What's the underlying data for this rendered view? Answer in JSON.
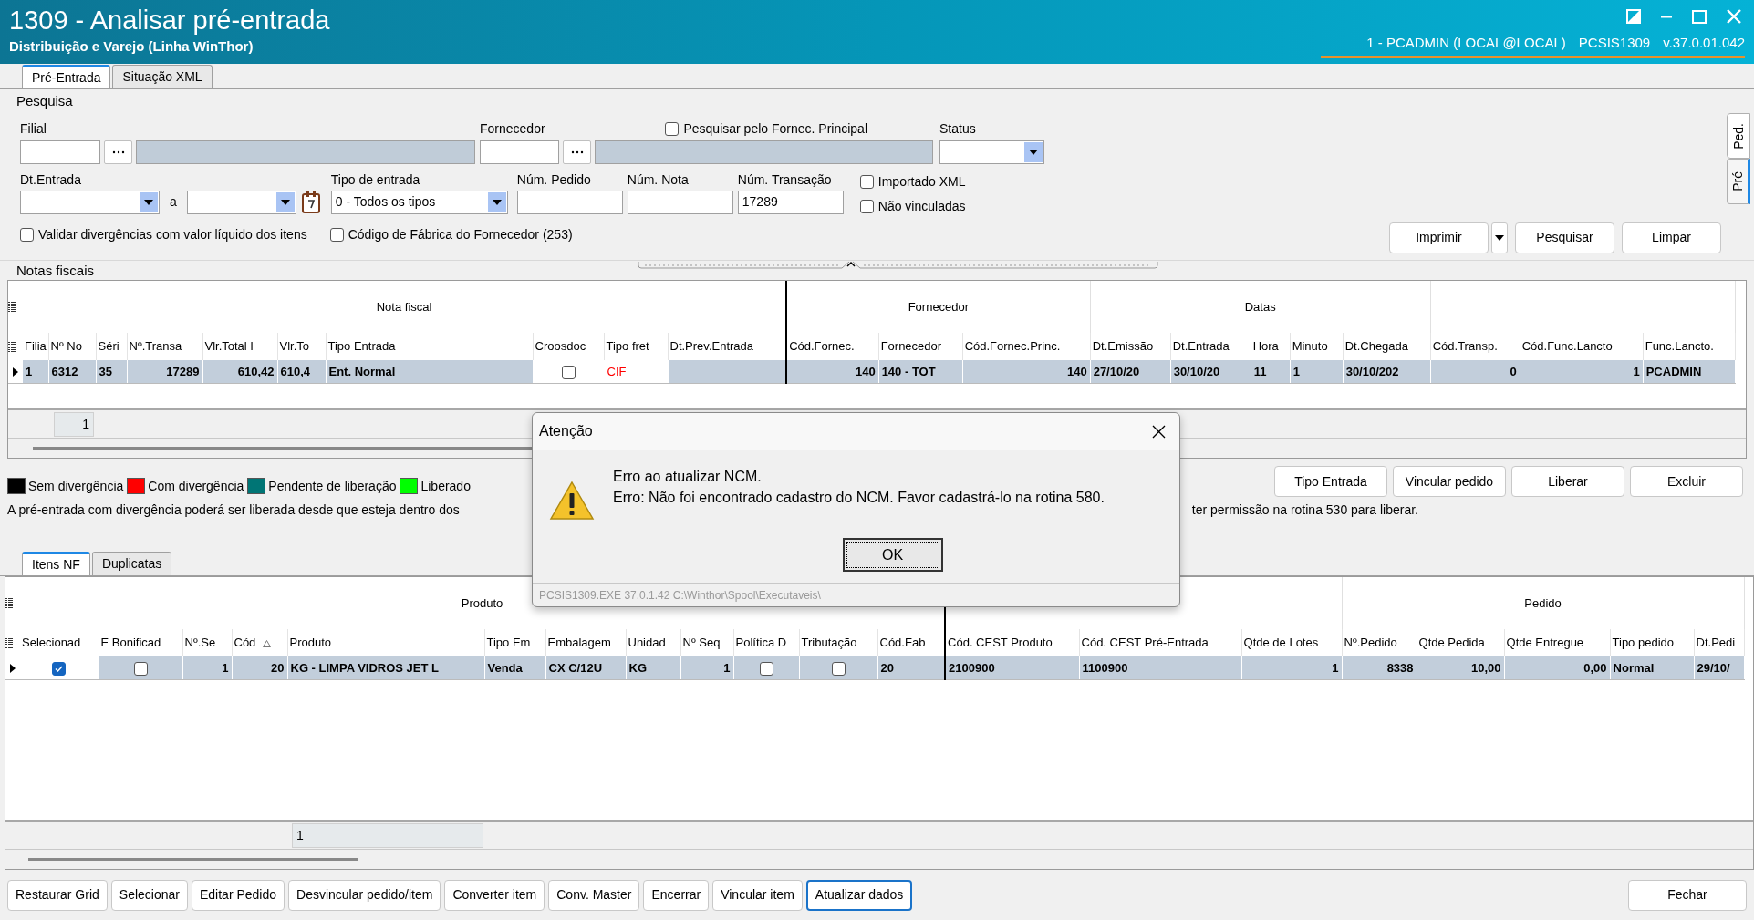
{
  "window": {
    "title": "1309 - Analisar pré-entrada",
    "subtitle": "Distribuição e Varejo (Linha WinThor)",
    "session": "1 - PCADMIN (LOCAL@LOCAL)",
    "program": "PCSIS1309",
    "version": "v.37.0.01.042"
  },
  "tabs": [
    {
      "label": "Pré-Entrada",
      "selected": true
    },
    {
      "label": "Situação XML",
      "selected": false
    }
  ],
  "search": {
    "title": "Pesquisa",
    "filial": {
      "label": "Filial"
    },
    "fornecedor": {
      "label": "Fornecedor"
    },
    "principal": {
      "label": "Pesquisar pelo Fornec. Principal",
      "checked": false
    },
    "status": {
      "label": "Status"
    },
    "dt_entrada": {
      "label": "Dt.Entrada",
      "separator": "a"
    },
    "tipo_entrada": {
      "label": "Tipo de entrada",
      "value": "0 - Todos os tipos"
    },
    "num_pedido": {
      "label": "Núm. Pedido"
    },
    "num_nota": {
      "label": "Núm. Nota"
    },
    "num_transacao": {
      "label": "Núm. Transação",
      "value": "17289"
    },
    "flags": [
      {
        "label": "Importado XML",
        "checked": false
      },
      {
        "label": "Não vinculadas",
        "checked": false
      }
    ],
    "options": [
      {
        "label": "Validar divergências com valor líquido dos itens",
        "checked": false
      },
      {
        "label": "Código de Fábrica do Fornecedor (253)",
        "checked": false
      }
    ],
    "buttons": [
      "Imprimir",
      "Pesquisar",
      "Limpar"
    ],
    "side_tabs": [
      {
        "label": "Ped.",
        "selected": false
      },
      {
        "label": "Pré",
        "selected": true
      }
    ]
  },
  "notas": {
    "title": "Notas fiscais",
    "groups": [
      "Nota fiscal",
      "Fornecedor",
      "Datas"
    ],
    "columns": [
      {
        "label": "Filia",
        "editable": false
      },
      {
        "label": "Nº No",
        "editable": false
      },
      {
        "label": "Séri",
        "editable": false
      },
      {
        "label": "Nº.Transa",
        "editable": false
      },
      {
        "label": "Vlr.Total I",
        "editable": false
      },
      {
        "label": "Vlr.To",
        "editable": false
      },
      {
        "label": "Tipo Entrada",
        "editable": false
      },
      {
        "label": "Croosdoc",
        "editable": true
      },
      {
        "label": "Tipo fret",
        "editable": true
      },
      {
        "label": "Dt.Prev.Entrada",
        "editable": false
      },
      {
        "label": "Cód.Fornec.",
        "editable": false
      },
      {
        "label": "Fornecedor",
        "editable": false
      },
      {
        "label": "Cód.Fornec.Princ.",
        "editable": false
      },
      {
        "label": "Dt.Emissão",
        "editable": false
      },
      {
        "label": "Dt.Entrada",
        "editable": false
      },
      {
        "label": "Hora",
        "editable": false
      },
      {
        "label": "Minuto",
        "editable": false
      },
      {
        "label": "Dt.Chegada",
        "editable": false
      },
      {
        "label": "Cód.Transp.",
        "editable": false
      },
      {
        "label": "Cód.Func.Lancto",
        "editable": false
      },
      {
        "label": "Func.Lancto.",
        "editable": false
      }
    ],
    "rows": [
      {
        "selected": true,
        "cells": [
          {
            "kind": "text",
            "text": "1"
          },
          {
            "kind": "text",
            "text": "6312"
          },
          {
            "kind": "text",
            "text": "35"
          },
          {
            "kind": "text",
            "text": "17289"
          },
          {
            "kind": "text",
            "text": "610,42"
          },
          {
            "kind": "text",
            "text": "610,4"
          },
          {
            "kind": "text",
            "text": "Ent. Normal"
          },
          {
            "kind": "checkbox",
            "checked": false
          },
          {
            "kind": "text",
            "text": "CIF",
            "color": "#ff0000"
          },
          {
            "kind": "empty"
          },
          {
            "kind": "text",
            "text": "140"
          },
          {
            "kind": "text",
            "text": "140 - TOT"
          },
          {
            "kind": "text",
            "text": "140"
          },
          {
            "kind": "text",
            "text": "27/10/20"
          },
          {
            "kind": "text",
            "text": "30/10/20"
          },
          {
            "kind": "text",
            "text": "11"
          },
          {
            "kind": "text",
            "text": "1"
          },
          {
            "kind": "text",
            "text": "30/10/202"
          },
          {
            "kind": "text",
            "text": "0"
          },
          {
            "kind": "text",
            "text": "1"
          },
          {
            "kind": "text",
            "text": "PCADMIN"
          }
        ]
      }
    ],
    "footer": "1"
  },
  "legend": [
    {
      "label": "Sem divergência",
      "color": "#000000"
    },
    {
      "label": "Com divergência",
      "color": "#ff0000"
    },
    {
      "label": "Pendente de liberação",
      "color": "#007575"
    },
    {
      "label": "Liberado",
      "color": "#00ff00"
    }
  ],
  "notice": {
    "before": "A pré-entrada com divergência poderá ser liberada desde que esteja dentro dos",
    "after": "ter permissão na rotina 530 para liberar."
  },
  "actions": [
    "Tipo Entrada",
    "Vincular pedido",
    "Liberar",
    "Excluir"
  ],
  "lower_tabs": [
    {
      "label": "Itens NF",
      "selected": true
    },
    {
      "label": "Duplicatas",
      "selected": false
    }
  ],
  "itens": {
    "groups": [
      "Produto",
      "Pedido"
    ],
    "columns": [
      {
        "label": "Selecionad",
        "editable": true,
        "sorted": false
      },
      {
        "label": "E Bonificad",
        "editable": false,
        "sorted": false
      },
      {
        "label": "Nº.Se",
        "editable": false,
        "sorted": false
      },
      {
        "label": "Cód",
        "editable": false,
        "sorted": true
      },
      {
        "label": "Produto",
        "editable": false,
        "sorted": false
      },
      {
        "label": "Tipo Em",
        "editable": false,
        "sorted": false
      },
      {
        "label": "Embalagem",
        "editable": false,
        "sorted": false
      },
      {
        "label": "Unidad",
        "editable": false,
        "sorted": false
      },
      {
        "label": "Nº Seq",
        "editable": false,
        "sorted": false
      },
      {
        "label": "Política D",
        "editable": false,
        "sorted": false
      },
      {
        "label": "Tributação",
        "editable": false,
        "sorted": false
      },
      {
        "label": "Cód.Fab",
        "editable": false,
        "sorted": false
      },
      {
        "label": "Cód. CEST Produto",
        "editable": false,
        "sorted": false
      },
      {
        "label": "Cód. CEST Pré-Entrada",
        "editable": false,
        "sorted": false
      },
      {
        "label": "Qtde de Lotes",
        "editable": false,
        "sorted": false
      },
      {
        "label": "Nº.Pedido",
        "editable": false,
        "sorted": false
      },
      {
        "label": "Qtde Pedida",
        "editable": false,
        "sorted": false
      },
      {
        "label": "Qtde Entregue",
        "editable": false,
        "sorted": false
      },
      {
        "label": "Tipo pedido",
        "editable": false,
        "sorted": false
      },
      {
        "label": "Dt.Pedi",
        "editable": false,
        "sorted": false
      }
    ],
    "rows": [
      {
        "selected": true,
        "cells": [
          {
            "kind": "checkbox",
            "checked": true
          },
          {
            "kind": "checkbox",
            "checked": false
          },
          {
            "kind": "text",
            "text": "1"
          },
          {
            "kind": "text",
            "text": "20"
          },
          {
            "kind": "text",
            "text": "KG - LIMPA VIDROS JET L"
          },
          {
            "kind": "text",
            "text": "Venda"
          },
          {
            "kind": "text",
            "text": "CX C/12U"
          },
          {
            "kind": "text",
            "text": "KG"
          },
          {
            "kind": "text",
            "text": "1"
          },
          {
            "kind": "checkbox",
            "checked": false
          },
          {
            "kind": "checkbox",
            "checked": false
          },
          {
            "kind": "text",
            "text": "20"
          },
          {
            "kind": "text",
            "text": "2100900"
          },
          {
            "kind": "text",
            "text": "1100900"
          },
          {
            "kind": "text",
            "text": "1"
          },
          {
            "kind": "text",
            "text": "8338"
          },
          {
            "kind": "text",
            "text": "10,00"
          },
          {
            "kind": "text",
            "text": "0,00"
          },
          {
            "kind": "text",
            "text": "Normal"
          },
          {
            "kind": "text",
            "text": "29/10/"
          }
        ]
      }
    ],
    "footer": "1"
  },
  "bottom_buttons": [
    {
      "label": "Restaurar Grid",
      "focused": false
    },
    {
      "label": "Selecionar",
      "focused": false
    },
    {
      "label": "Editar Pedido",
      "focused": false
    },
    {
      "label": "Desvincular pedido/item",
      "focused": false
    },
    {
      "label": "Converter item",
      "focused": false
    },
    {
      "label": "Conv. Master",
      "focused": false
    },
    {
      "label": "Encerrar",
      "focused": false
    },
    {
      "label": "Vincular item",
      "focused": false
    },
    {
      "label": "Atualizar dados",
      "focused": true
    }
  ],
  "close_button": "Fechar",
  "dialog": {
    "title": "Atenção",
    "lines": [
      "Erro ao atualizar NCM.",
      "Erro: Não foi encontrado cadastro do NCM. Favor cadastrá-lo na rotina 580."
    ],
    "ok": "OK",
    "footer": "PCSIS1309.EXE 37.0.1.42 C:\\Winthor\\Spool\\Executaveis\\"
  }
}
